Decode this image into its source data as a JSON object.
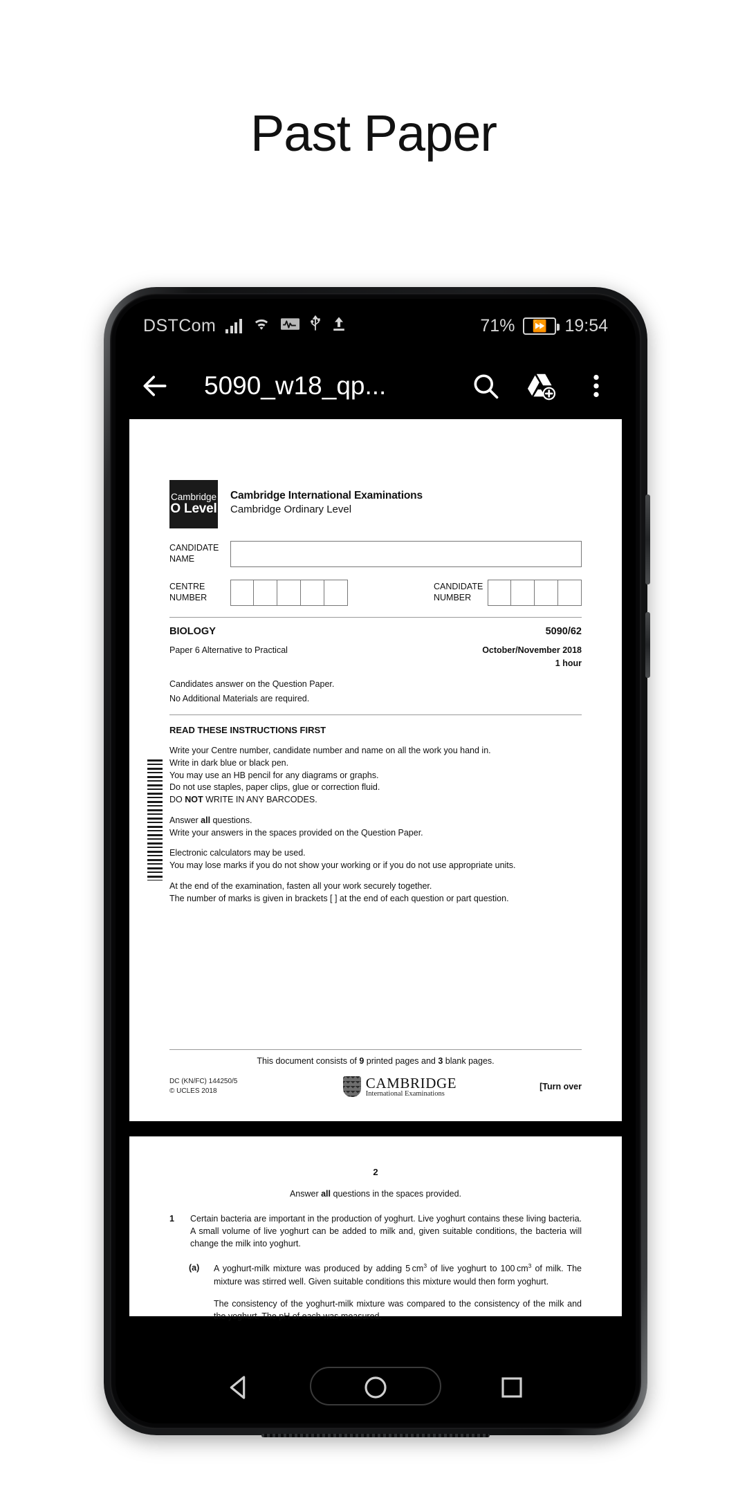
{
  "page_heading": "Past Paper",
  "status_bar": {
    "carrier": "DSTCom",
    "icons": [
      "signal-icon",
      "wifi-icon",
      "data-activity-icon",
      "usb-icon",
      "upload-icon"
    ],
    "battery_percent": "71%",
    "battery_state": "charging",
    "clock": "19:54"
  },
  "toolbar": {
    "back_label": "←",
    "title": "5090_w18_qp...",
    "actions": [
      "search-icon",
      "add-to-drive-icon",
      "overflow-menu-icon"
    ]
  },
  "document": {
    "logo": {
      "line1": "Cambridge",
      "line2": "O Level"
    },
    "org_title": "Cambridge International Examinations",
    "org_sub": "Cambridge Ordinary Level",
    "fields": {
      "candidate_name_label": "CANDIDATE\nNAME",
      "candidate_name_value": "",
      "centre_number_label": "CENTRE\nNUMBER",
      "centre_number_cells": 5,
      "candidate_number_label": "CANDIDATE\nNUMBER",
      "candidate_number_cells": 4
    },
    "subject": "BIOLOGY",
    "paper_code": "5090/62",
    "paper": "Paper 6  Alternative to Practical",
    "session": "October/November 2018",
    "duration": "1 hour",
    "answer_note": "Candidates answer on the Question Paper.",
    "materials_note": "No Additional Materials are required.",
    "instructions_title": "READ THESE INSTRUCTIONS FIRST",
    "instructions_block1": [
      "Write your Centre number, candidate number and name on all the work you hand in.",
      "Write in dark blue or black pen.",
      "You may use an HB pencil for any diagrams or graphs.",
      "Do not use staples, paper clips, glue or correction fluid."
    ],
    "instructions_barcode_pre": "DO ",
    "instructions_barcode_bold": "NOT",
    "instructions_barcode_post": " WRITE IN ANY BARCODES.",
    "instructions_block2_pre": "Answer ",
    "instructions_block2_bold": "all",
    "instructions_block2_post": " questions.",
    "instructions_block2_line2": "Write your answers in the spaces provided on the Question Paper.",
    "instructions_block3": [
      "Electronic calculators may be used.",
      "You may lose marks if you do not show your working or if you do not use appropriate units."
    ],
    "instructions_block4": [
      "At the end of the examination, fasten all your work securely together.",
      "The number of marks is given in brackets [  ] at the end of each question or part question."
    ],
    "footer": {
      "consists_pre": "This document consists of ",
      "consists_printed": "9",
      "consists_mid": " printed pages and ",
      "consists_blank": "3",
      "consists_post": " blank pages.",
      "dc_line1": "DC (KN/FC) 144250/5",
      "dc_line2": "© UCLES 2018",
      "cambridge_name": "CAMBRIDGE",
      "cambridge_sub": "International Examinations",
      "turn_over": "[Turn over"
    }
  },
  "page2": {
    "number": "2",
    "subhead_pre": "Answer ",
    "subhead_bold": "all",
    "subhead_post": " questions in the spaces provided.",
    "q1_number": "1",
    "q1_text": "Certain bacteria are important in the production of yoghurt. Live yoghurt contains these living bacteria. A small volume of live yoghurt can be added to milk and, given suitable conditions, the bacteria will change the milk into yoghurt.",
    "q1a_label": "(a)",
    "q1a_p1_a": "A yoghurt-milk mixture was produced by adding 5 cm",
    "q1a_p1_sup1": "3",
    "q1a_p1_b": " of live yoghurt to 100 cm",
    "q1a_p1_sup2": "3",
    "q1a_p1_c": " of milk. The mixture was stirred well. Given suitable conditions this mixture would then form yoghurt.",
    "q1a_p2": "The consistency of the yoghurt-milk mixture was compared to the consistency of the milk and the yoghurt. The pH of each was measured."
  },
  "nav_bar": {
    "items": [
      "back-triangle-icon",
      "home-circle-icon",
      "recents-square-icon"
    ]
  },
  "colors": {
    "screen_bg": "#000000",
    "paper": "#ffffff",
    "text": "#111111"
  }
}
